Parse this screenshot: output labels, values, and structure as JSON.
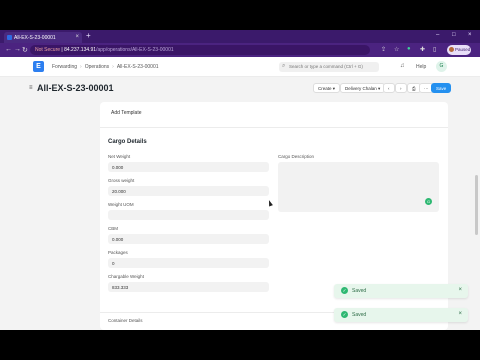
{
  "browser": {
    "tab_title": "All-EX-S-23-00001",
    "address": {
      "warning": "Not Secure",
      "host": "84.237.134.91",
      "path": "/app/operations/All-EX-S-23-00001"
    },
    "profile_label": "Paused"
  },
  "navbar": {
    "logo_letter": "E",
    "breadcrumbs": [
      "Forwarding",
      "Operations",
      "All-EX-S-23-00001"
    ],
    "search_placeholder": "Search or type a command (Ctrl + G)",
    "help_label": "Help",
    "avatar_initial": "G"
  },
  "page": {
    "title": "All-EX-S-23-00001",
    "buttons": {
      "create": "Create",
      "delivery_challan": "Delivery Chalan",
      "save": "Save"
    }
  },
  "form": {
    "add_template": "Add Template",
    "section_title": "Cargo Details",
    "fields": {
      "net_weight": {
        "label": "Net Weight",
        "value": "0.000"
      },
      "gross_weight": {
        "label": "Gross weight",
        "value": "20.000"
      },
      "weight_uom": {
        "label": "Weight UOM",
        "value": ""
      },
      "cbm": {
        "label": "CBM",
        "value": "0.000"
      },
      "packages": {
        "label": "Packages",
        "value": "0"
      },
      "chargable_weight": {
        "label": "Chargable Weight",
        "value": "833.333"
      },
      "cargo_description": {
        "label": "Cargo Description",
        "value": ""
      }
    },
    "next_section_title": "Container Details"
  },
  "toasts": [
    {
      "text": "Saved"
    },
    {
      "text": "Saved"
    }
  ],
  "colors": {
    "browser_chrome": "#4b2380",
    "primary": "#2490ef",
    "success": "#2eb872"
  }
}
